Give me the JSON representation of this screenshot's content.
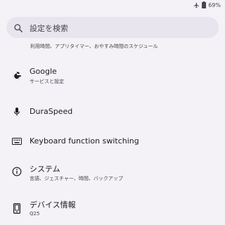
{
  "status_bar": {
    "battery_text": "69%",
    "icons": [
      "airplane-icon",
      "battery-icon"
    ]
  },
  "search": {
    "placeholder": "設定を検索",
    "suggestion": "利用時間、アプリタイマー、おやすみ時間のスケジュール"
  },
  "settings": [
    {
      "icon": "google-icon",
      "title": "Google",
      "subtitle": "サービスと設定"
    },
    {
      "icon": "microphone-icon",
      "title": "DuraSpeed",
      "subtitle": ""
    },
    {
      "icon": "keyboard-icon",
      "title": "Keyboard function switching",
      "subtitle": ""
    },
    {
      "icon": "info-icon",
      "title": "システム",
      "subtitle": "言語、ジェスチャー、時間、バックアップ"
    },
    {
      "icon": "device-icon",
      "title": "デバイス情報",
      "subtitle": "Q25"
    }
  ],
  "colors": {
    "background": "#f4f2f7",
    "search_bg": "#e8e5ee",
    "text_primary": "#1c1b1f",
    "text_secondary": "#49454f"
  }
}
